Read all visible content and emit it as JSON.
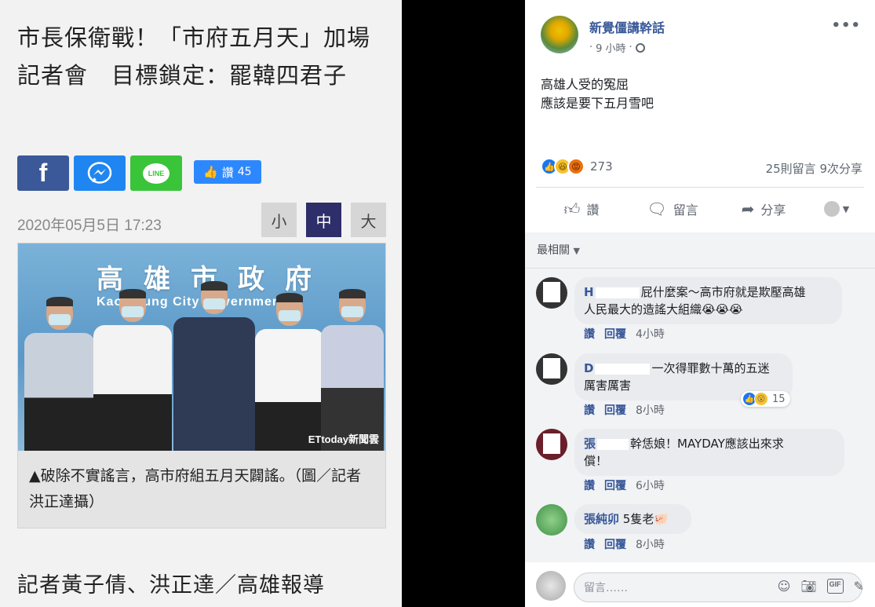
{
  "article": {
    "headline": "市長保衛戰！「市府五月天」加場記者會　目標鎖定：罷韓四君子",
    "share": {
      "facebook_label": "f",
      "line_label": "LINE",
      "like_label": "讚",
      "like_count": "45"
    },
    "date": "2020年05月5日 17:23",
    "font_sizes": [
      "小",
      "中",
      "大"
    ],
    "font_size_selected": "中",
    "photo": {
      "sign_zh": "高雄市政府",
      "sign_en": "Kaohsiung City Government",
      "watermark": "ETtoday新聞雲",
      "caption": "▲破除不實謠言，高市府組五月天闢謠。（圖／記者洪正達攝）"
    },
    "reporter": "記者黃子倩、洪正達／高雄報導"
  },
  "post": {
    "page_name": "新覺僵講幹話",
    "time_ago": "9 小時",
    "body_lines": [
      "高雄人受的冤屈",
      "應該是要下五月雪吧"
    ],
    "reaction_count": "273",
    "comments_shares": "25則留言  9次分享",
    "actions": {
      "like": "讚",
      "comment": "留言",
      "share": "分享"
    },
    "sort_label": "最相關",
    "reply_placeholder": "留言……"
  },
  "comments": [
    {
      "name": "H",
      "text": "屁什麼案～高市府就是欺壓高雄人民最大的造謠大組織😭😭😭",
      "line1": "屁什麼案～高市府就是欺壓高雄",
      "line2": "人民最大的造謠大組織😭😭😭",
      "like_label": "讚",
      "reply_label": "回覆",
      "time": "4小時"
    },
    {
      "name": "D",
      "line1": "一次得罪數十萬的五迷",
      "line2": "厲害厲害",
      "like_label": "讚",
      "reply_label": "回覆",
      "time": "8小時",
      "reaction_count": "15"
    },
    {
      "name": "張",
      "line1": "幹恁娘！MAYDAY應該出來求",
      "line2": "償！",
      "like_label": "讚",
      "reply_label": "回覆",
      "time": "6小時"
    },
    {
      "name": "張純卯",
      "line1": "5隻老🐖",
      "like_label": "讚",
      "reply_label": "回覆",
      "time": "8小時"
    }
  ],
  "colors": {
    "facebook_blue": "#3b5998",
    "messenger_blue": "#1f86f1",
    "line_green": "#3ac43a",
    "fb_link": "#385898",
    "selected_size": "#2e2e6a"
  }
}
